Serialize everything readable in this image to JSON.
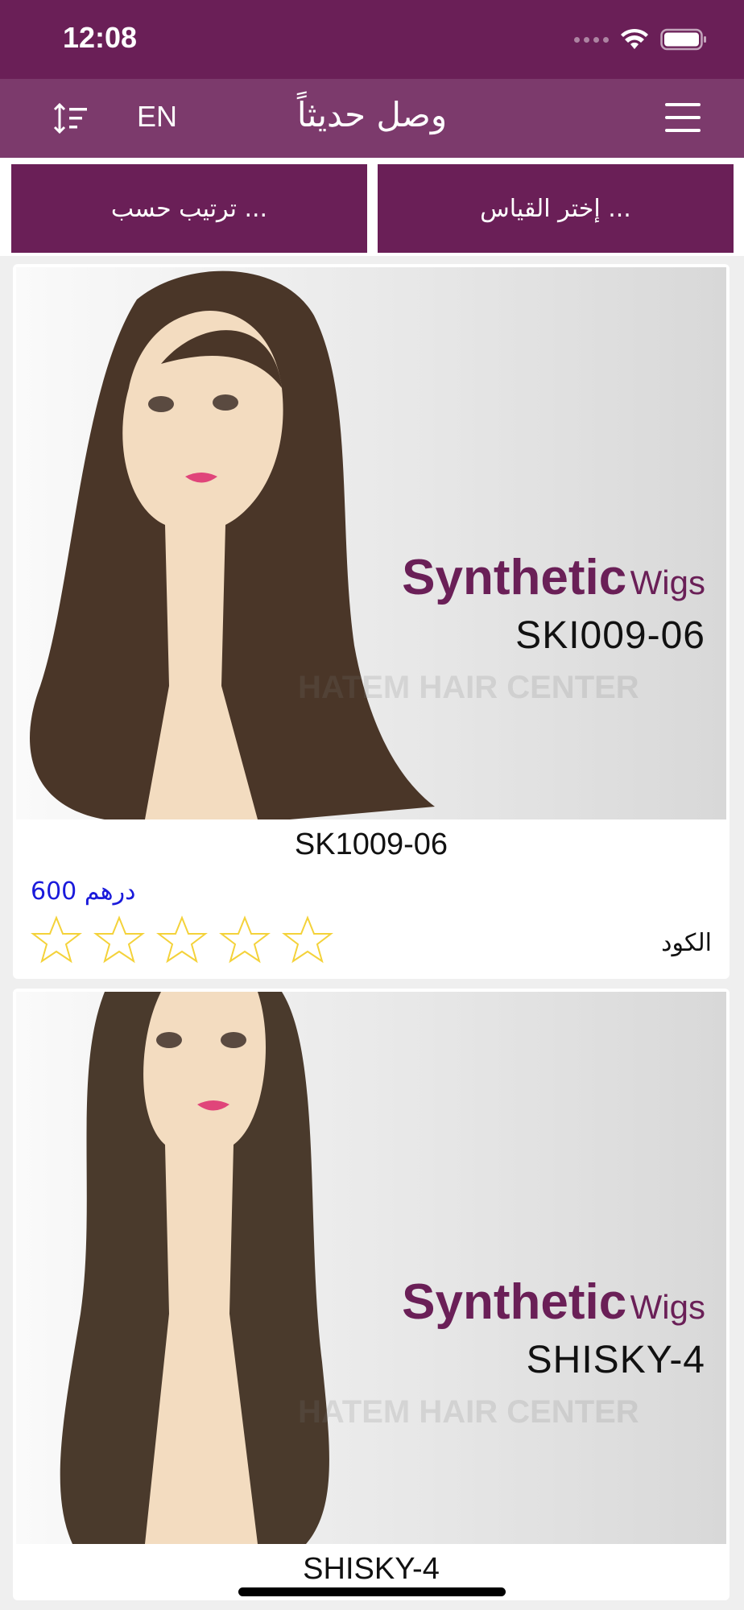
{
  "status_bar": {
    "time": "12:08"
  },
  "nav": {
    "title": "وصل حديثاً",
    "language": "EN"
  },
  "filters": {
    "size_button": "إختر القياس ...",
    "sort_button": "ترتيب حسب ..."
  },
  "products": [
    {
      "image_brand_bold": "Synthetic",
      "image_brand_light": "Wigs",
      "image_code": "SKI009-06",
      "watermark": "HATEM HAIR CENTER",
      "name": "SK1009-06",
      "price_value": "600",
      "currency": "درهم",
      "code_label": "الكود",
      "rating": 0,
      "rating_max": 5
    },
    {
      "image_brand_bold": "Synthetic",
      "image_brand_light": "Wigs",
      "image_code": "SHISKY-4",
      "watermark": "HATEM HAIR CENTER",
      "name": "SHISKY-4"
    }
  ],
  "colors": {
    "brand": "#6a1f57",
    "nav": "#7c3a6c",
    "price": "#1a1adb",
    "star": "#f4d23a"
  }
}
